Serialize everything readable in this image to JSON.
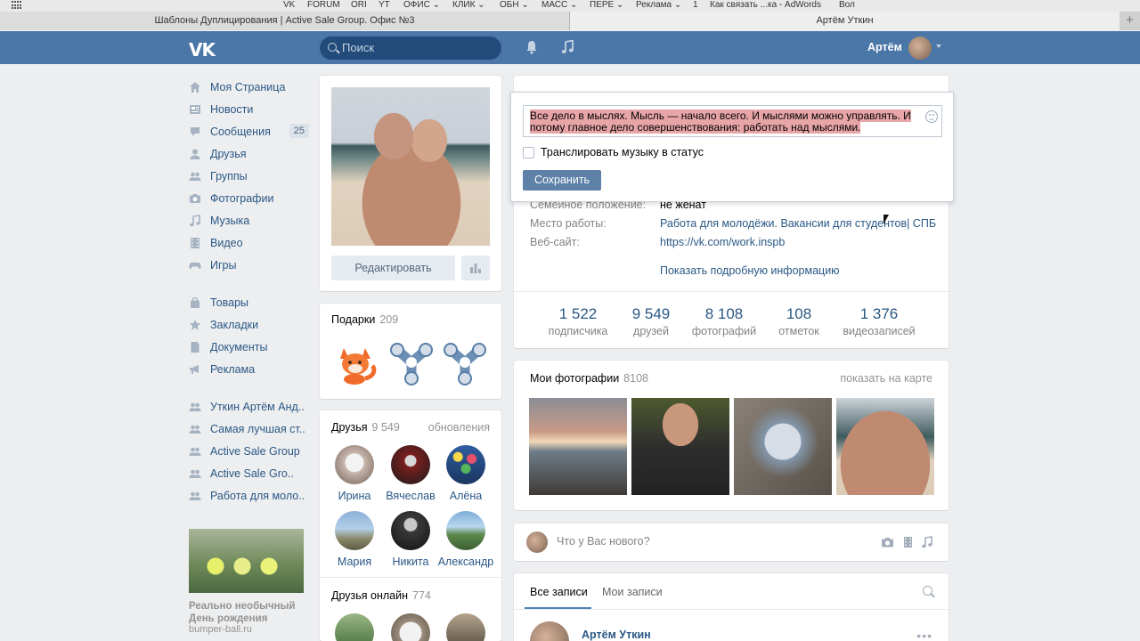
{
  "browser": {
    "bookmarks": [
      "VK",
      "FORUM",
      "ORI",
      "YT",
      "ОФИС ⌄",
      "КЛИК ⌄",
      "ОБН ⌄",
      "МАСС ⌄",
      "ПЕРЕ ⌄",
      "Реклама ⌄",
      "1",
      "Как связать ...ка - AdWords",
      "Вол"
    ],
    "tabs": [
      "Шаблоны Дуплицирования | Active Sale Group. Офис №3",
      "Артём Уткин"
    ],
    "new_tab_label": "+"
  },
  "header": {
    "logo": "VK",
    "search_placeholder": "Поиск",
    "user_name": "Артём"
  },
  "sidebar": {
    "items": [
      {
        "label": "Моя Страница",
        "icon": "home-icon"
      },
      {
        "label": "Новости",
        "icon": "news-icon"
      },
      {
        "label": "Сообщения",
        "icon": "messages-icon",
        "badge": "25"
      },
      {
        "label": "Друзья",
        "icon": "friends-icon"
      },
      {
        "label": "Группы",
        "icon": "groups-icon"
      },
      {
        "label": "Фотографии",
        "icon": "camera-icon"
      },
      {
        "label": "Музыка",
        "icon": "music-icon"
      },
      {
        "label": "Видео",
        "icon": "video-icon"
      },
      {
        "label": "Игры",
        "icon": "gamepad-icon"
      }
    ],
    "items2": [
      {
        "label": "Товары",
        "icon": "bag-icon"
      },
      {
        "label": "Закладки",
        "icon": "star-icon"
      },
      {
        "label": "Документы",
        "icon": "document-icon"
      },
      {
        "label": "Реклама",
        "icon": "megaphone-icon"
      }
    ],
    "groups": [
      {
        "label": "Уткин Артём Анд..",
        "icon": "group-icon"
      },
      {
        "label": "Самая лучшая ст..",
        "icon": "group-icon"
      },
      {
        "label": "Active Sale Group",
        "icon": "group-icon"
      },
      {
        "label": "Active Sale Gro..",
        "icon": "group-icon"
      },
      {
        "label": "Работа для моло..",
        "icon": "group-icon"
      }
    ],
    "ad": {
      "title": "Реально необычный День рождения",
      "site": "bumper-ball.ru"
    }
  },
  "profile": {
    "edit_label": "Редактировать",
    "gifts": {
      "title": "Подарки",
      "count": "209"
    },
    "friends": {
      "title": "Друзья",
      "count": "9 549",
      "updates": "обновления",
      "list": [
        "Ирина",
        "Вячеслав",
        "Алёна",
        "Мария",
        "Никита",
        "Александр"
      ]
    },
    "online": {
      "title": "Друзья онлайн",
      "count": "774"
    }
  },
  "info": {
    "rows": [
      {
        "label": "Семейное положение:",
        "value": "не женат",
        "link": false
      },
      {
        "label": "Место работы:",
        "value": "Работа для молодёжи. Вакансии для студентов| СПБ",
        "link": true
      },
      {
        "label": "Веб-сайт:",
        "value": "https://vk.com/work.inspb",
        "link": true
      }
    ],
    "more": "Показать подробную информацию",
    "counters": [
      {
        "num": "1 522",
        "label": "подписчика"
      },
      {
        "num": "9 549",
        "label": "друзей"
      },
      {
        "num": "8 108",
        "label": "фотографий"
      },
      {
        "num": "108",
        "label": "отметок"
      },
      {
        "num": "1 376",
        "label": "видеозаписей"
      }
    ]
  },
  "status_popup": {
    "text": "Все дело в мыслях. Мысль — начало всего. И мыслями можно управлять. И потому главное дело совершенствования: работать над мыслями.",
    "broadcast_label": "Транслировать музыку в статус",
    "save_label": "Сохранить"
  },
  "photos": {
    "title": "Мои фотографии",
    "count": "8108",
    "map_link": "показать на карте"
  },
  "composer": {
    "placeholder": "Что у Вас нового?"
  },
  "wall": {
    "tabs": [
      "Все записи",
      "Мои записи"
    ],
    "post_author": "Артём Уткин",
    "more": "•••"
  },
  "colors": {
    "header": "#4a76a8",
    "link": "#2a5885",
    "background": "#edeef0",
    "button": "#5e81a8"
  }
}
